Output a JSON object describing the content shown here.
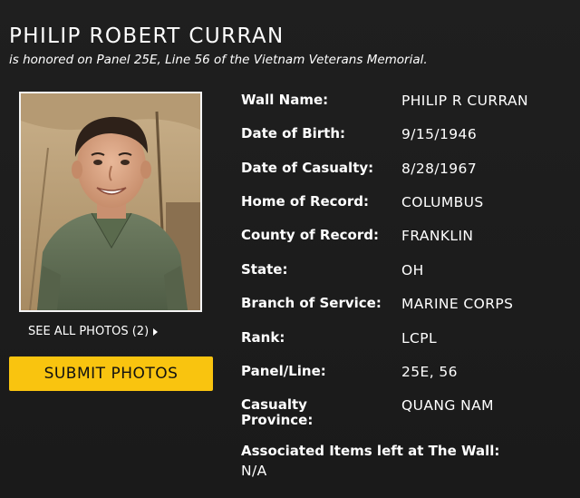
{
  "header": {
    "name": "PHILIP ROBERT CURRAN",
    "subtitle": "is honored on Panel 25E, Line 56 of the Vietnam Veterans Memorial."
  },
  "photo": {
    "see_all_label": "SEE ALL PHOTOS (2)",
    "submit_label": "SUBMIT PHOTOS"
  },
  "details": {
    "wall_name": {
      "label": "Wall Name:",
      "value": "PHILIP R CURRAN"
    },
    "date_of_birth": {
      "label": "Date of Birth:",
      "value": "9/15/1946"
    },
    "date_of_casualty": {
      "label": "Date of Casualty:",
      "value": "8/28/1967"
    },
    "home_of_record": {
      "label": "Home of Record:",
      "value": "COLUMBUS"
    },
    "county_of_record": {
      "label": "County of Record:",
      "value": "FRANKLIN"
    },
    "state": {
      "label": "State:",
      "value": "OH"
    },
    "branch_of_service": {
      "label": "Branch of Service:",
      "value": "MARINE CORPS"
    },
    "rank": {
      "label": "Rank:",
      "value": "LCPL"
    },
    "panel_line": {
      "label": "Panel/Line:",
      "value": "25E, 56"
    },
    "casualty_province": {
      "label_line1": "Casualty",
      "label_line2": "Province:",
      "value": "QUANG NAM"
    }
  },
  "associated_items": {
    "label": "Associated Items left at The Wall:",
    "value": "N/A"
  },
  "colors": {
    "background": "#1c1c1c",
    "accent_button": "#f9c40f",
    "text": "#ffffff"
  }
}
